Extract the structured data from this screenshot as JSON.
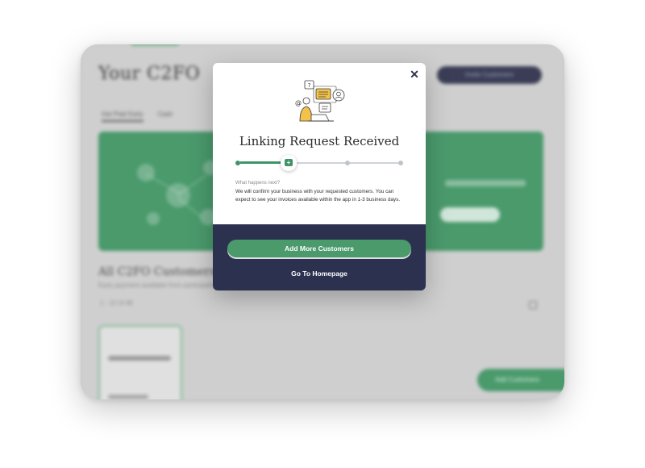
{
  "background_app": {
    "title": "Your C2FO",
    "header_pill": "Invite Customers",
    "subtabs": [
      "Get Paid Early",
      "Cash"
    ],
    "section_title": "All C2FO Customers",
    "section_subtitle": "Early payment available from participating customers",
    "filter_label": "1 - 12 of 48",
    "fab_label": "Add Customers"
  },
  "modal": {
    "close_icon": "close-icon",
    "illustration_icon": "person-at-laptop-illustration",
    "title": "Linking Request Received",
    "stepper": {
      "current_step": 2,
      "total_steps": 4,
      "current_icon": "chat-plus-icon"
    },
    "next_label": "What happens next?",
    "next_body": "We will confirm your business with your requested customers. You can expect to see your invoices available within the app in 1-3 business days.",
    "primary_button": "Add More Customers",
    "secondary_link": "Go To Homepage"
  },
  "colors": {
    "brand_green": "#4a9a6c",
    "navy": "#2c3150",
    "close": "#2d3250"
  }
}
